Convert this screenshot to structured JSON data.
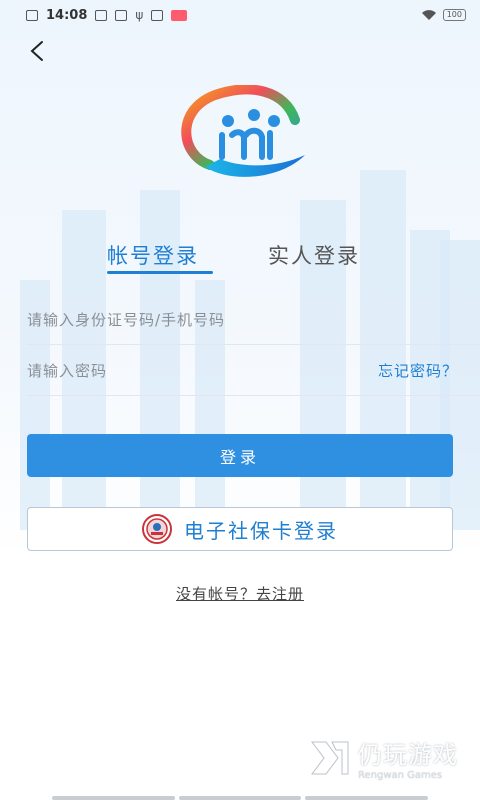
{
  "status_bar": {
    "time": "14:08",
    "battery": "100"
  },
  "tabs": [
    {
      "label": "帐号登录",
      "active": true
    },
    {
      "label": "实人登录",
      "active": false
    }
  ],
  "form": {
    "id_placeholder": "请输入身份证号码/手机号码",
    "password_placeholder": "请输入密码",
    "forgot_password": "忘记密码？"
  },
  "buttons": {
    "login": "登录",
    "social_security_card": "电子社保卡登录"
  },
  "register": {
    "text": "没有帐号？去注册"
  },
  "watermark": {
    "main": "仍玩游戏",
    "sub": "Rengwan Games"
  },
  "colors": {
    "accent": "#1f7fd2",
    "button": "#2f8fe0"
  }
}
